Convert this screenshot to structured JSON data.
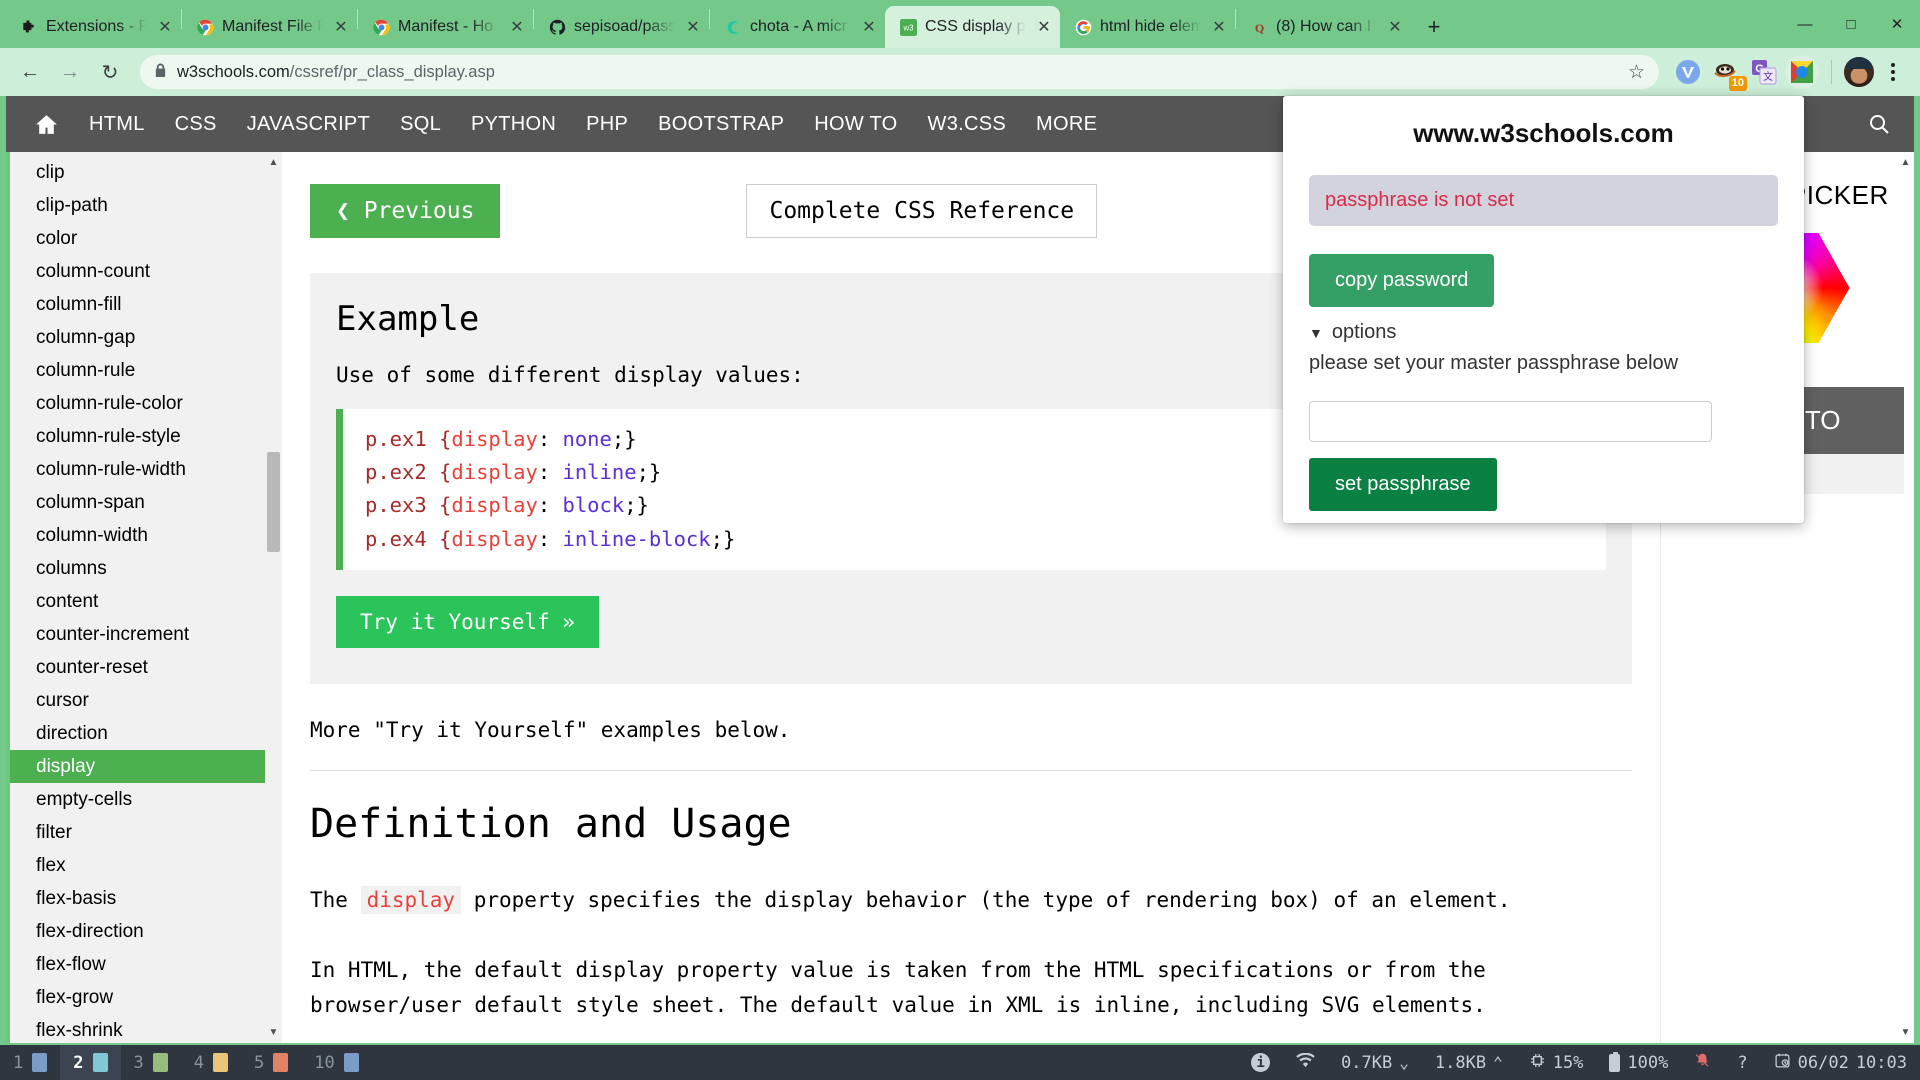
{
  "browser": {
    "tabs": [
      {
        "title": "Extensions - P",
        "favicon": "puzzle-piece-icon",
        "glyph": "❖",
        "color": "#1b1b1b",
        "active": false
      },
      {
        "title": "Manifest File F",
        "favicon": "chrome-icon",
        "glyph": "",
        "color": "",
        "active": false
      },
      {
        "title": "Manifest - Ho",
        "favicon": "chrome-icon",
        "glyph": "",
        "color": "",
        "active": false
      },
      {
        "title": "sepisoad/pass",
        "favicon": "github-icon",
        "glyph": "●",
        "color": "#24292e",
        "active": false
      },
      {
        "title": "chota - A micr",
        "favicon": "chota-icon",
        "glyph": "C",
        "color": "#1fc8a9",
        "active": false
      },
      {
        "title": "CSS display pr",
        "favicon": "w3schools-icon",
        "glyph": "w3",
        "color": "#4CAF50",
        "active": true
      },
      {
        "title": "html hide elem",
        "favicon": "google-icon",
        "glyph": "G",
        "color": "#4285f4",
        "active": false
      },
      {
        "title": "(8) How can I",
        "favicon": "quora-icon",
        "glyph": "Q",
        "color": "#b92b27",
        "active": false
      }
    ],
    "new_tab_label": "+",
    "window_controls": {
      "minimize": "—",
      "maximize": "□",
      "close": "✕"
    },
    "nav": {
      "back": "←",
      "forward": "→",
      "reload": "↻"
    },
    "omnibox": {
      "lock_icon": "lock-icon",
      "domain": "w3schools.com",
      "path": "/cssref/pr_class_display.asp",
      "star_icon": "bookmark-star-icon"
    },
    "extensions": [
      {
        "name": "vimium-extension",
        "glyph": "V",
        "badge": ""
      },
      {
        "name": "tampermonkey-extension",
        "glyph": "🐒",
        "badge": "10"
      },
      {
        "name": "google-translate-extension",
        "glyph": "G",
        "badge": ""
      },
      {
        "name": "passhub-extension",
        "glyph": "◉",
        "badge": ""
      }
    ],
    "profile": "user-avatar",
    "menu": "chrome-menu-icon"
  },
  "w3nav": {
    "home_icon": "home-icon",
    "items": [
      "HTML",
      "CSS",
      "JAVASCRIPT",
      "SQL",
      "PYTHON",
      "PHP",
      "BOOTSTRAP",
      "HOW TO",
      "W3.CSS",
      "MORE"
    ],
    "search_icon": "search-icon"
  },
  "sidebar": {
    "items": [
      "clip",
      "clip-path",
      "color",
      "column-count",
      "column-fill",
      "column-gap",
      "column-rule",
      "column-rule-color",
      "column-rule-style",
      "column-rule-width",
      "column-span",
      "column-width",
      "columns",
      "content",
      "counter-increment",
      "counter-reset",
      "cursor",
      "direction",
      "display",
      "empty-cells",
      "filter",
      "flex",
      "flex-basis",
      "flex-direction",
      "flex-flow",
      "flex-grow",
      "flex-shrink"
    ],
    "active": "display",
    "scroll_up": "▲",
    "scroll_down": "▼"
  },
  "main": {
    "previous_button": "❮ Previous",
    "reference_button": "Complete CSS Reference",
    "example": {
      "heading": "Example",
      "lead": "Use of some different display values:",
      "code_lines": [
        {
          "selector": "p.ex1 {",
          "prop": "display",
          "colon": ": ",
          "value": "none",
          "end": ";}"
        },
        {
          "selector": "p.ex2 {",
          "prop": "display",
          "colon": ": ",
          "value": "inline",
          "end": ";}"
        },
        {
          "selector": "p.ex3 {",
          "prop": "display",
          "colon": ": ",
          "value": "block",
          "end": ";}"
        },
        {
          "selector": "p.ex4 {",
          "prop": "display",
          "colon": ": ",
          "value": "inline-block",
          "end": ";}"
        }
      ],
      "try_button": "Try it Yourself »"
    },
    "more_examples": "More \"Try it Yourself\" examples below.",
    "definition": {
      "heading": "Definition and Usage",
      "p1_before": "The ",
      "p1_code": "display",
      "p1_after": " property specifies the display behavior (the type of rendering box) of an element.",
      "p2": "In HTML, the default display property value is taken from the HTML specifications or from the browser/user default style sheet. The default value in XML is inline, including SVG elements."
    }
  },
  "rightbar": {
    "color_picker_title": "COLOR PICKER",
    "color_picker_icon": "color-hexagon-icon",
    "howto_button": "HOW TO",
    "scroll_up": "▲",
    "scroll_down": "▼"
  },
  "popup": {
    "title": "www.w3schools.com",
    "status": "passphrase is not set",
    "copy_button": "copy password",
    "options_caret": "▼",
    "options_label": "options",
    "hint": "please set your master passphrase below",
    "passphrase_value": "",
    "passphrase_placeholder": "",
    "set_button": "set passphrase",
    "colors": {
      "status_text": "#d62b4a",
      "copy_bg": "#34a065",
      "set_bg": "#0a8043"
    }
  },
  "taskbar": {
    "workspaces": [
      {
        "num": "1",
        "color": "#7a9cc6",
        "active": false
      },
      {
        "num": "2",
        "color": "#82c7d4",
        "active": true
      },
      {
        "num": "3",
        "color": "#97bd7d",
        "active": false
      },
      {
        "num": "4",
        "color": "#eac478",
        "active": false
      },
      {
        "num": "5",
        "color": "#e28264",
        "active": false
      },
      {
        "num": "10",
        "color": "#7a9cc6",
        "active": false
      }
    ],
    "tray": {
      "info_icon": "info-icon",
      "wifi_icon": "wifi-icon",
      "download_rate": "0.7KB",
      "download_caret": "⌄",
      "upload_rate": "1.8KB",
      "upload_caret": "⌃",
      "cpu_icon": "cpu-icon",
      "cpu_value": "15%",
      "battery_icon": "battery-icon",
      "battery_value": "100%",
      "bell_icon": "bell-muted-icon",
      "help_label": "?",
      "clock_icon": "clock-icon",
      "date": "06/02",
      "time": "10:03"
    }
  }
}
